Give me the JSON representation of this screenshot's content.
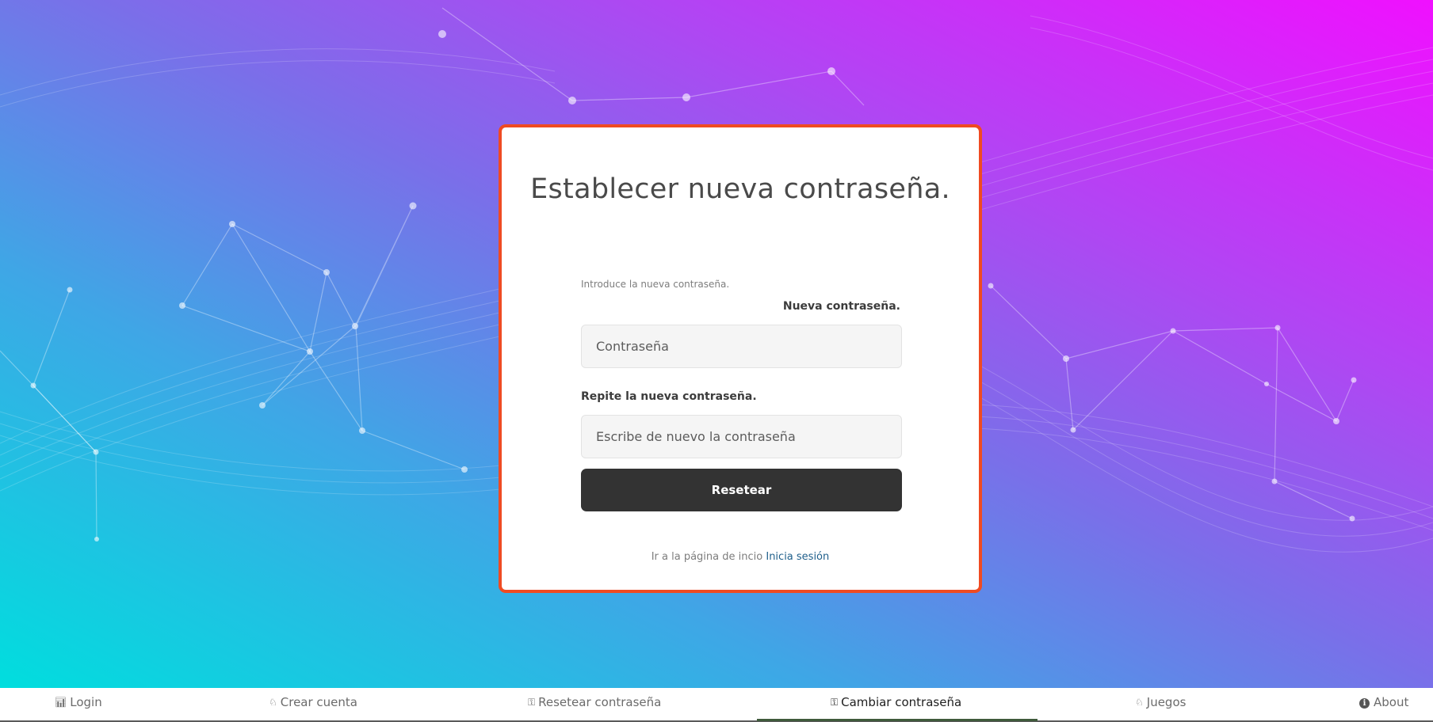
{
  "card": {
    "title": "Establecer nueva contraseña.",
    "intro": "Introduce la nueva contraseña.",
    "new_password_label": "Nueva contraseña.",
    "new_password_placeholder": "Contraseña",
    "repeat_password_label": "Repite la nueva contraseña.",
    "repeat_password_placeholder": "Escribe de nuevo la contraseña",
    "submit_label": "Resetear",
    "footer_text": "Ir a la página de incio",
    "footer_link": "Inicia sesión"
  },
  "nav": {
    "items": [
      {
        "label": "Login",
        "icon": "chart-icon"
      },
      {
        "label": "Crear cuenta",
        "icon": "puzzle-icon"
      },
      {
        "label": "Resetear contraseña",
        "icon": "key-icon"
      },
      {
        "label": "Cambiar contraseña",
        "icon": "key-icon",
        "active": true
      },
      {
        "label": "Juegos",
        "icon": "puzzle-icon"
      },
      {
        "label": "About",
        "icon": "info-icon"
      }
    ]
  },
  "colors": {
    "card_border": "#ef4b22",
    "button_bg": "#333333",
    "link": "#1f5f8b",
    "gradient_start": "#00dede",
    "gradient_end": "#f010ff"
  }
}
